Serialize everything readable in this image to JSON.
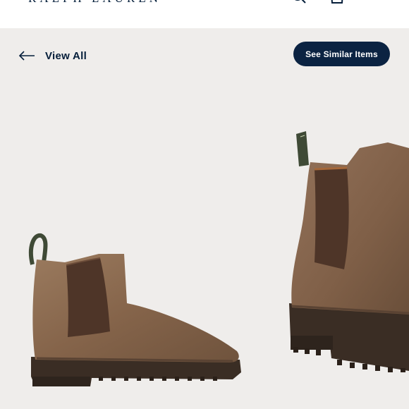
{
  "header": {
    "brand": "RALPH LAUREN",
    "icons": [
      "search-icon",
      "bag-icon",
      "menu-icon"
    ]
  },
  "nav": {
    "view_all_label": "View All",
    "back_icon": "arrow-left-icon"
  },
  "actions": {
    "see_similar_label": "See Similar Items"
  },
  "product": {
    "image": "brown-suede-chelsea-boots",
    "colors": {
      "suede": "#8a6a50",
      "elastic": "#4e3528",
      "sole": "#3a2d24",
      "pull_tab": "#3f4a36",
      "button_bg": "#0b2342",
      "brand_navy": "#041e3a"
    }
  }
}
